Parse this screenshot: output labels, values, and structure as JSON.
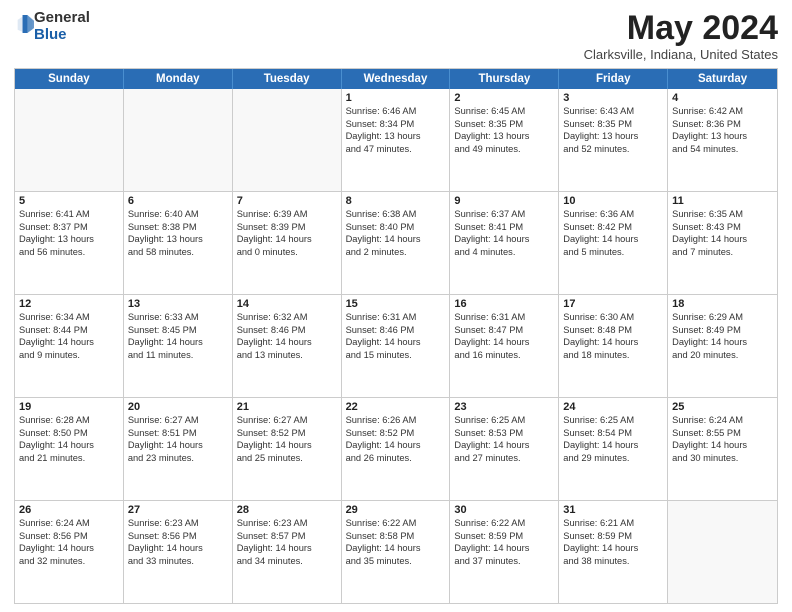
{
  "logo": {
    "general": "General",
    "blue": "Blue"
  },
  "title": "May 2024",
  "subtitle": "Clarksville, Indiana, United States",
  "header_days": [
    "Sunday",
    "Monday",
    "Tuesday",
    "Wednesday",
    "Thursday",
    "Friday",
    "Saturday"
  ],
  "weeks": [
    [
      {
        "day": "",
        "lines": []
      },
      {
        "day": "",
        "lines": []
      },
      {
        "day": "",
        "lines": []
      },
      {
        "day": "1",
        "lines": [
          "Sunrise: 6:46 AM",
          "Sunset: 8:34 PM",
          "Daylight: 13 hours",
          "and 47 minutes."
        ]
      },
      {
        "day": "2",
        "lines": [
          "Sunrise: 6:45 AM",
          "Sunset: 8:35 PM",
          "Daylight: 13 hours",
          "and 49 minutes."
        ]
      },
      {
        "day": "3",
        "lines": [
          "Sunrise: 6:43 AM",
          "Sunset: 8:35 PM",
          "Daylight: 13 hours",
          "and 52 minutes."
        ]
      },
      {
        "day": "4",
        "lines": [
          "Sunrise: 6:42 AM",
          "Sunset: 8:36 PM",
          "Daylight: 13 hours",
          "and 54 minutes."
        ]
      }
    ],
    [
      {
        "day": "5",
        "lines": [
          "Sunrise: 6:41 AM",
          "Sunset: 8:37 PM",
          "Daylight: 13 hours",
          "and 56 minutes."
        ]
      },
      {
        "day": "6",
        "lines": [
          "Sunrise: 6:40 AM",
          "Sunset: 8:38 PM",
          "Daylight: 13 hours",
          "and 58 minutes."
        ]
      },
      {
        "day": "7",
        "lines": [
          "Sunrise: 6:39 AM",
          "Sunset: 8:39 PM",
          "Daylight: 14 hours",
          "and 0 minutes."
        ]
      },
      {
        "day": "8",
        "lines": [
          "Sunrise: 6:38 AM",
          "Sunset: 8:40 PM",
          "Daylight: 14 hours",
          "and 2 minutes."
        ]
      },
      {
        "day": "9",
        "lines": [
          "Sunrise: 6:37 AM",
          "Sunset: 8:41 PM",
          "Daylight: 14 hours",
          "and 4 minutes."
        ]
      },
      {
        "day": "10",
        "lines": [
          "Sunrise: 6:36 AM",
          "Sunset: 8:42 PM",
          "Daylight: 14 hours",
          "and 5 minutes."
        ]
      },
      {
        "day": "11",
        "lines": [
          "Sunrise: 6:35 AM",
          "Sunset: 8:43 PM",
          "Daylight: 14 hours",
          "and 7 minutes."
        ]
      }
    ],
    [
      {
        "day": "12",
        "lines": [
          "Sunrise: 6:34 AM",
          "Sunset: 8:44 PM",
          "Daylight: 14 hours",
          "and 9 minutes."
        ]
      },
      {
        "day": "13",
        "lines": [
          "Sunrise: 6:33 AM",
          "Sunset: 8:45 PM",
          "Daylight: 14 hours",
          "and 11 minutes."
        ]
      },
      {
        "day": "14",
        "lines": [
          "Sunrise: 6:32 AM",
          "Sunset: 8:46 PM",
          "Daylight: 14 hours",
          "and 13 minutes."
        ]
      },
      {
        "day": "15",
        "lines": [
          "Sunrise: 6:31 AM",
          "Sunset: 8:46 PM",
          "Daylight: 14 hours",
          "and 15 minutes."
        ]
      },
      {
        "day": "16",
        "lines": [
          "Sunrise: 6:31 AM",
          "Sunset: 8:47 PM",
          "Daylight: 14 hours",
          "and 16 minutes."
        ]
      },
      {
        "day": "17",
        "lines": [
          "Sunrise: 6:30 AM",
          "Sunset: 8:48 PM",
          "Daylight: 14 hours",
          "and 18 minutes."
        ]
      },
      {
        "day": "18",
        "lines": [
          "Sunrise: 6:29 AM",
          "Sunset: 8:49 PM",
          "Daylight: 14 hours",
          "and 20 minutes."
        ]
      }
    ],
    [
      {
        "day": "19",
        "lines": [
          "Sunrise: 6:28 AM",
          "Sunset: 8:50 PM",
          "Daylight: 14 hours",
          "and 21 minutes."
        ]
      },
      {
        "day": "20",
        "lines": [
          "Sunrise: 6:27 AM",
          "Sunset: 8:51 PM",
          "Daylight: 14 hours",
          "and 23 minutes."
        ]
      },
      {
        "day": "21",
        "lines": [
          "Sunrise: 6:27 AM",
          "Sunset: 8:52 PM",
          "Daylight: 14 hours",
          "and 25 minutes."
        ]
      },
      {
        "day": "22",
        "lines": [
          "Sunrise: 6:26 AM",
          "Sunset: 8:52 PM",
          "Daylight: 14 hours",
          "and 26 minutes."
        ]
      },
      {
        "day": "23",
        "lines": [
          "Sunrise: 6:25 AM",
          "Sunset: 8:53 PM",
          "Daylight: 14 hours",
          "and 27 minutes."
        ]
      },
      {
        "day": "24",
        "lines": [
          "Sunrise: 6:25 AM",
          "Sunset: 8:54 PM",
          "Daylight: 14 hours",
          "and 29 minutes."
        ]
      },
      {
        "day": "25",
        "lines": [
          "Sunrise: 6:24 AM",
          "Sunset: 8:55 PM",
          "Daylight: 14 hours",
          "and 30 minutes."
        ]
      }
    ],
    [
      {
        "day": "26",
        "lines": [
          "Sunrise: 6:24 AM",
          "Sunset: 8:56 PM",
          "Daylight: 14 hours",
          "and 32 minutes."
        ]
      },
      {
        "day": "27",
        "lines": [
          "Sunrise: 6:23 AM",
          "Sunset: 8:56 PM",
          "Daylight: 14 hours",
          "and 33 minutes."
        ]
      },
      {
        "day": "28",
        "lines": [
          "Sunrise: 6:23 AM",
          "Sunset: 8:57 PM",
          "Daylight: 14 hours",
          "and 34 minutes."
        ]
      },
      {
        "day": "29",
        "lines": [
          "Sunrise: 6:22 AM",
          "Sunset: 8:58 PM",
          "Daylight: 14 hours",
          "and 35 minutes."
        ]
      },
      {
        "day": "30",
        "lines": [
          "Sunrise: 6:22 AM",
          "Sunset: 8:59 PM",
          "Daylight: 14 hours",
          "and 37 minutes."
        ]
      },
      {
        "day": "31",
        "lines": [
          "Sunrise: 6:21 AM",
          "Sunset: 8:59 PM",
          "Daylight: 14 hours",
          "and 38 minutes."
        ]
      },
      {
        "day": "",
        "lines": []
      }
    ]
  ]
}
